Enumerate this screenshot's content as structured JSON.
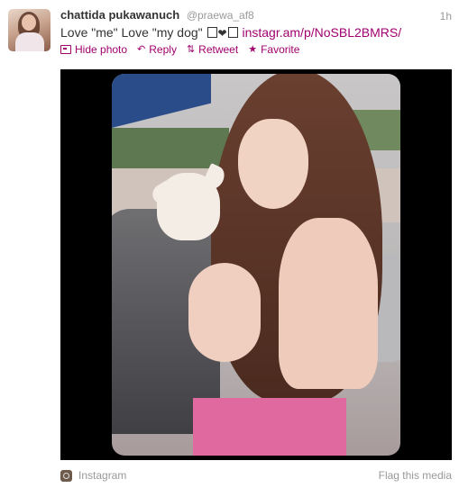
{
  "tweet": {
    "name": "chattida pukawanuch",
    "handle": "@praewa_af8",
    "time": "1h",
    "text_prefix": "Love \"me\" Love \"my dog\"",
    "heart": "❤",
    "link": "instagr.am/p/NoSBL2BMRS/"
  },
  "actions": {
    "hide_photo": "Hide photo",
    "reply": "Reply",
    "retweet": "Retweet",
    "favorite": "Favorite"
  },
  "media": {
    "source": "Instagram",
    "flag": "Flag this media"
  },
  "colors": {
    "link": "#a0006e",
    "muted": "#999999",
    "media_bg": "#000000"
  }
}
